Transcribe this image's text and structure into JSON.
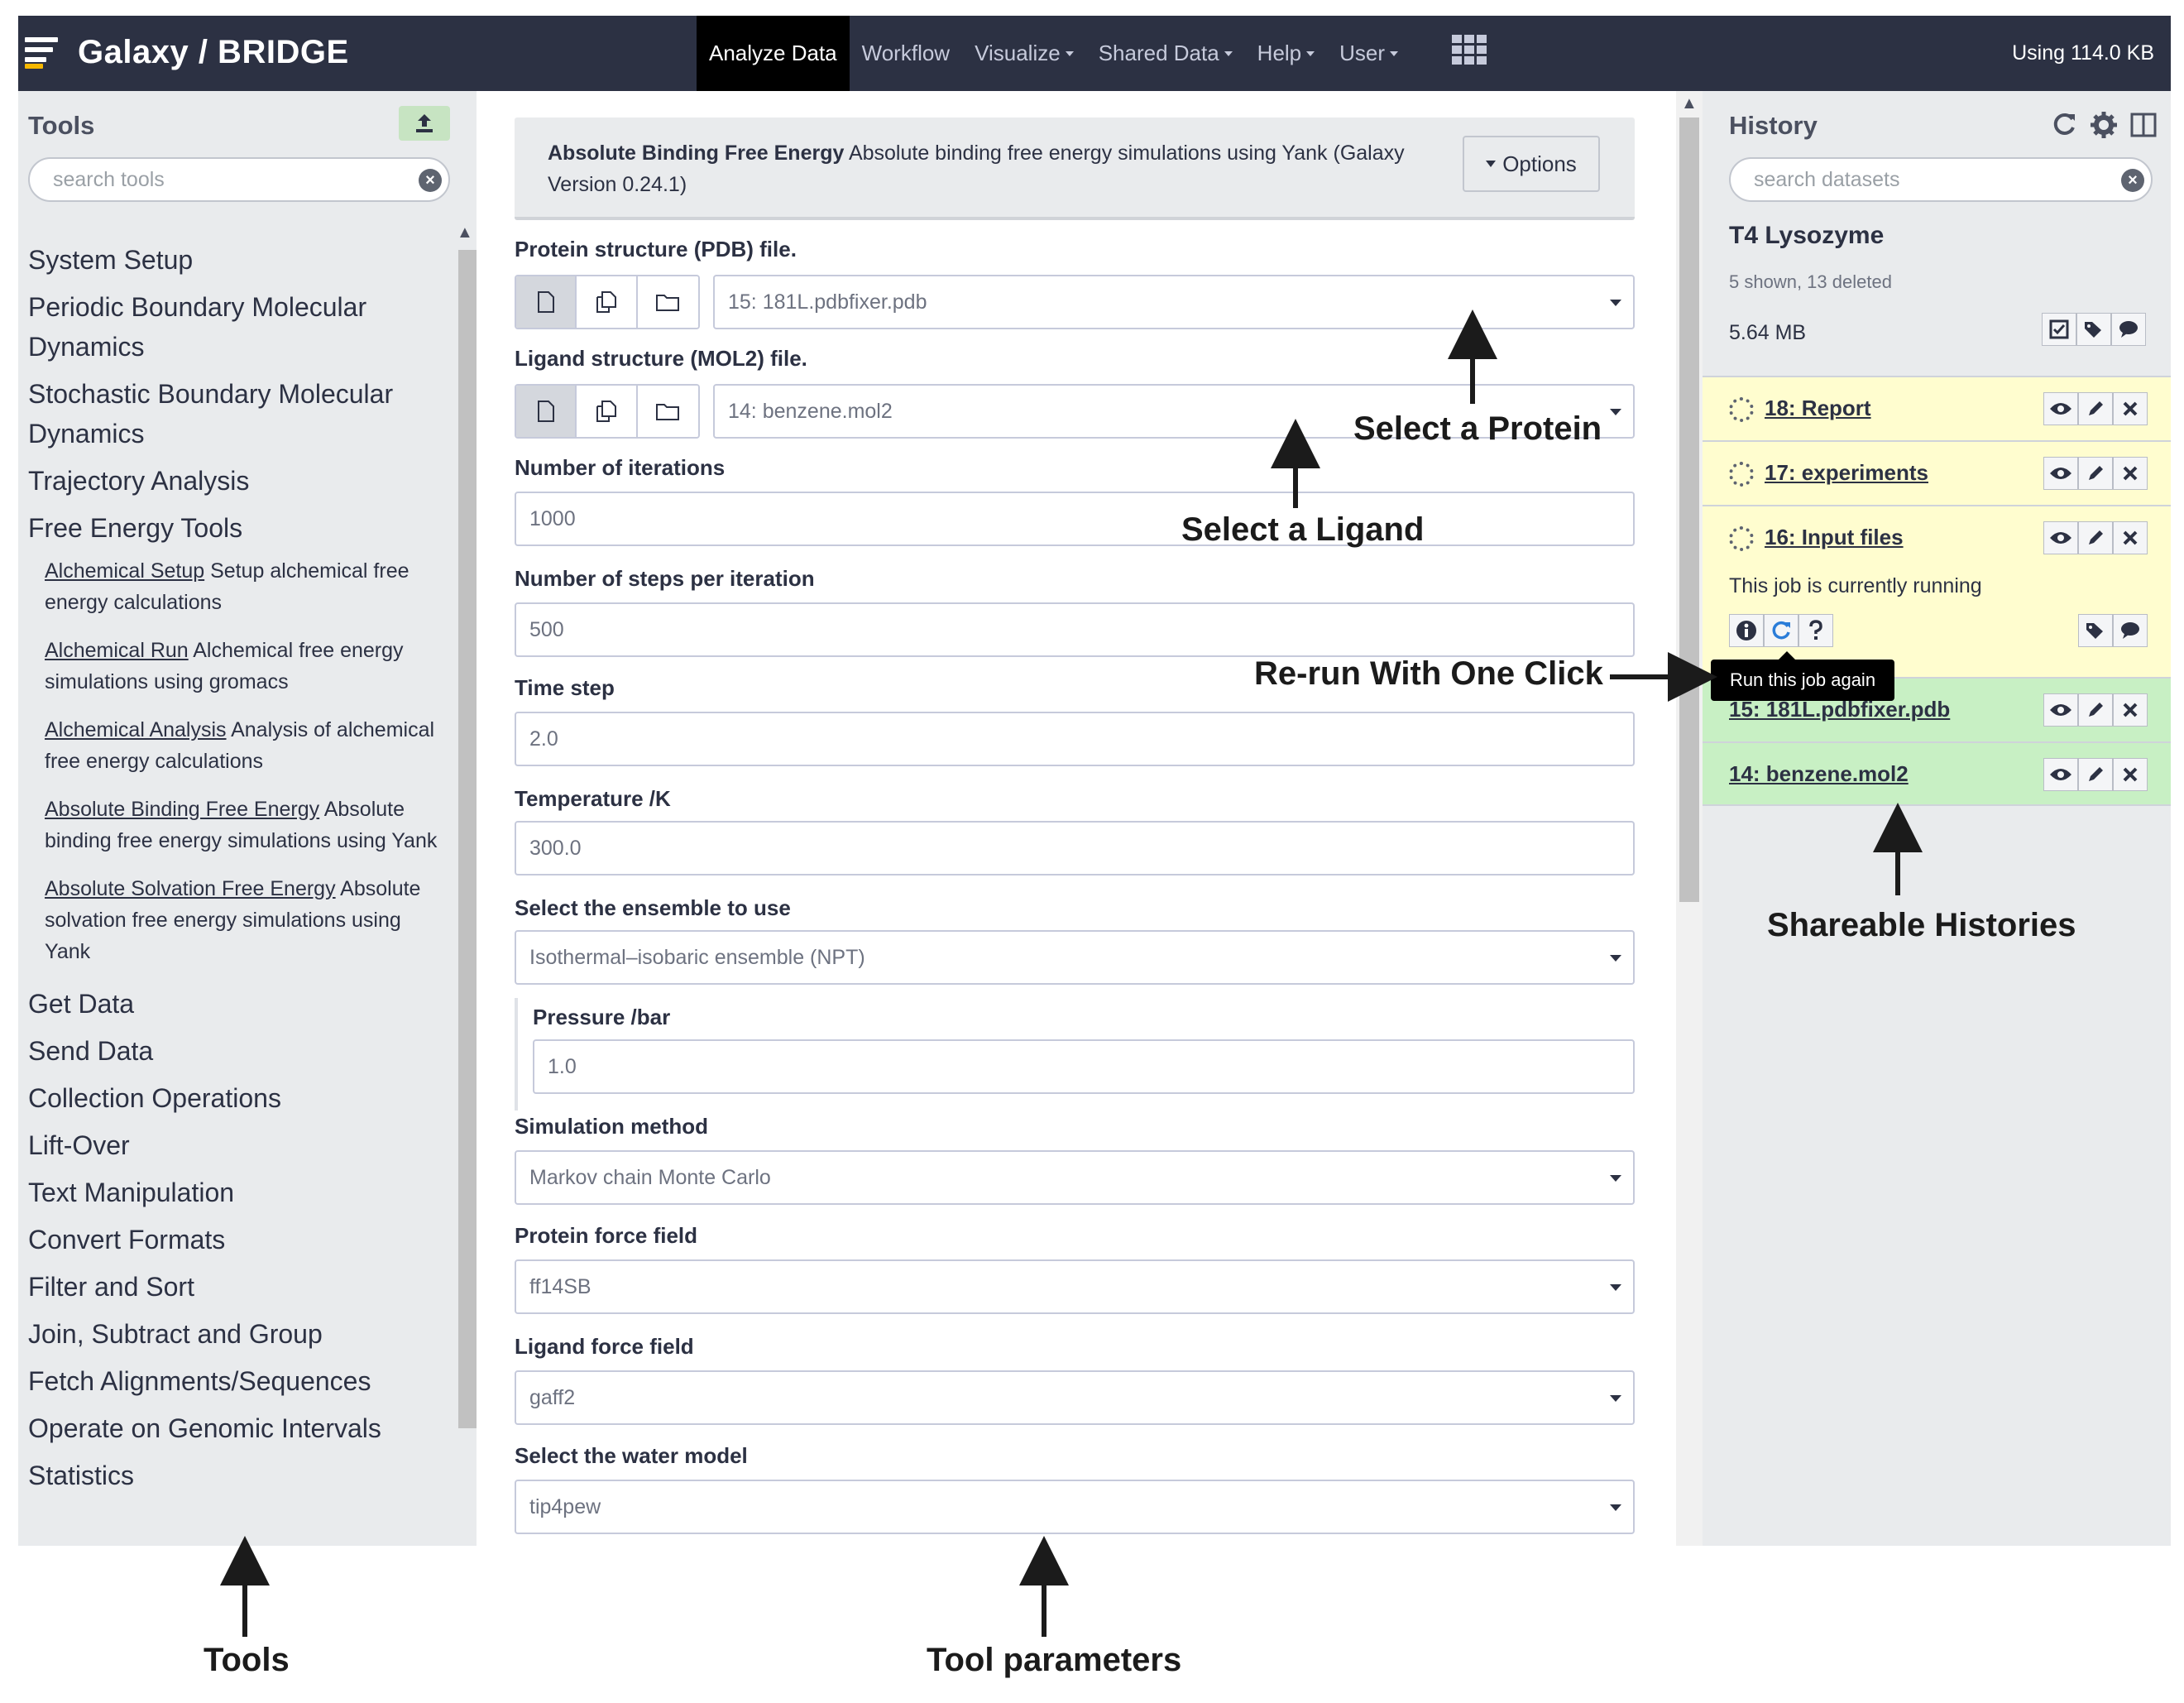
{
  "masthead": {
    "brand": "Galaxy / BRIDGE",
    "nav": [
      {
        "label": "Analyze Data",
        "active": true,
        "dropdown": false
      },
      {
        "label": "Workflow",
        "active": false,
        "dropdown": false
      },
      {
        "label": "Visualize",
        "active": false,
        "dropdown": true
      },
      {
        "label": "Shared Data",
        "active": false,
        "dropdown": true
      },
      {
        "label": "Help",
        "active": false,
        "dropdown": true
      },
      {
        "label": "User",
        "active": false,
        "dropdown": true
      }
    ],
    "quota": "Using 114.0 KB",
    "colors": {
      "background": "#2c3143",
      "active_tab": "#000000",
      "logo_accent": "#f6b800"
    }
  },
  "tool_panel": {
    "title": "Tools",
    "search_placeholder": "search tools",
    "sections": [
      {
        "label": "System Setup"
      },
      {
        "label": "Periodic Boundary Molecular Dynamics"
      },
      {
        "label": "Stochastic Boundary Molecular Dynamics"
      },
      {
        "label": "Trajectory Analysis"
      },
      {
        "label": "Free Energy Tools",
        "expanded": true,
        "tools": [
          {
            "name": "Alchemical Setup",
            "desc": " Setup alchemical free energy calculations"
          },
          {
            "name": "Alchemical Run",
            "desc": " Alchemical free energy simulations using gromacs"
          },
          {
            "name": "Alchemical Analysis",
            "desc": " Analysis of alchemical free energy calculations"
          },
          {
            "name": "Absolute Binding Free Energy",
            "desc": " Absolute binding free energy simulations using Yank"
          },
          {
            "name": "Absolute Solvation Free Energy",
            "desc": " Absolute solvation free energy simulations using Yank"
          }
        ]
      },
      {
        "label": "Get Data"
      },
      {
        "label": "Send Data"
      },
      {
        "label": "Collection Operations"
      },
      {
        "label": "Lift-Over"
      },
      {
        "label": "Text Manipulation"
      },
      {
        "label": "Convert Formats"
      },
      {
        "label": "Filter and Sort"
      },
      {
        "label": "Join, Subtract and Group"
      },
      {
        "label": "Fetch Alignments/Sequences"
      },
      {
        "label": "Operate on Genomic Intervals"
      },
      {
        "label": "Statistics"
      }
    ]
  },
  "tool_form": {
    "header_name": "Absolute Binding Free Energy",
    "header_desc": " Absolute binding free energy simulations using Yank (Galaxy Version 0.24.1)",
    "options_label": "Options",
    "protein_label": "Protein structure (PDB) file.",
    "protein_value": "15: 181L.pdbfixer.pdb",
    "ligand_label": "Ligand structure (MOL2) file.",
    "ligand_value": "14: benzene.mol2",
    "iterations_label": "Number of iterations",
    "iterations_value": "1000",
    "steps_label": "Number of steps per iteration",
    "steps_value": "500",
    "timestep_label": "Time step",
    "timestep_value": "2.0",
    "temperature_label": "Temperature /K",
    "temperature_value": "300.0",
    "ensemble_label": "Select the ensemble to use",
    "ensemble_value": "Isothermal–isobaric ensemble (NPT)",
    "pressure_label": "Pressure /bar",
    "pressure_value": "1.0",
    "method_label": "Simulation method",
    "method_value": "Markov chain Monte Carlo",
    "protein_ff_label": "Protein force field",
    "protein_ff_value": "ff14SB",
    "ligand_ff_label": "Ligand force field",
    "ligand_ff_value": "gaff2",
    "water_label": "Select the water model",
    "water_value": "tip4pew"
  },
  "history": {
    "title": "History",
    "search_placeholder": "search datasets",
    "name": "T4 Lysozyme",
    "counts": "5 shown, 13 deleted",
    "size": "5.64 MB",
    "datasets": [
      {
        "title": "18: Report",
        "state": "running"
      },
      {
        "title": "17: experiments",
        "state": "running"
      },
      {
        "title": "16: Input files",
        "state": "running",
        "message": "This job is currently running"
      },
      {
        "title": "15: 181L.pdbfixer.pdb",
        "state": "ok"
      },
      {
        "title": "14: benzene.mol2",
        "state": "ok"
      }
    ],
    "tooltip": "Run this job again",
    "colors": {
      "running": "#fffdcf",
      "ok": "#c8f0c4"
    }
  },
  "annotations": {
    "select_protein": "Select a Protein",
    "select_ligand": "Select a Ligand",
    "rerun": "Re-run With One Click",
    "shareable": "Shareable Histories",
    "tools": "Tools",
    "tool_parameters": "Tool parameters"
  }
}
